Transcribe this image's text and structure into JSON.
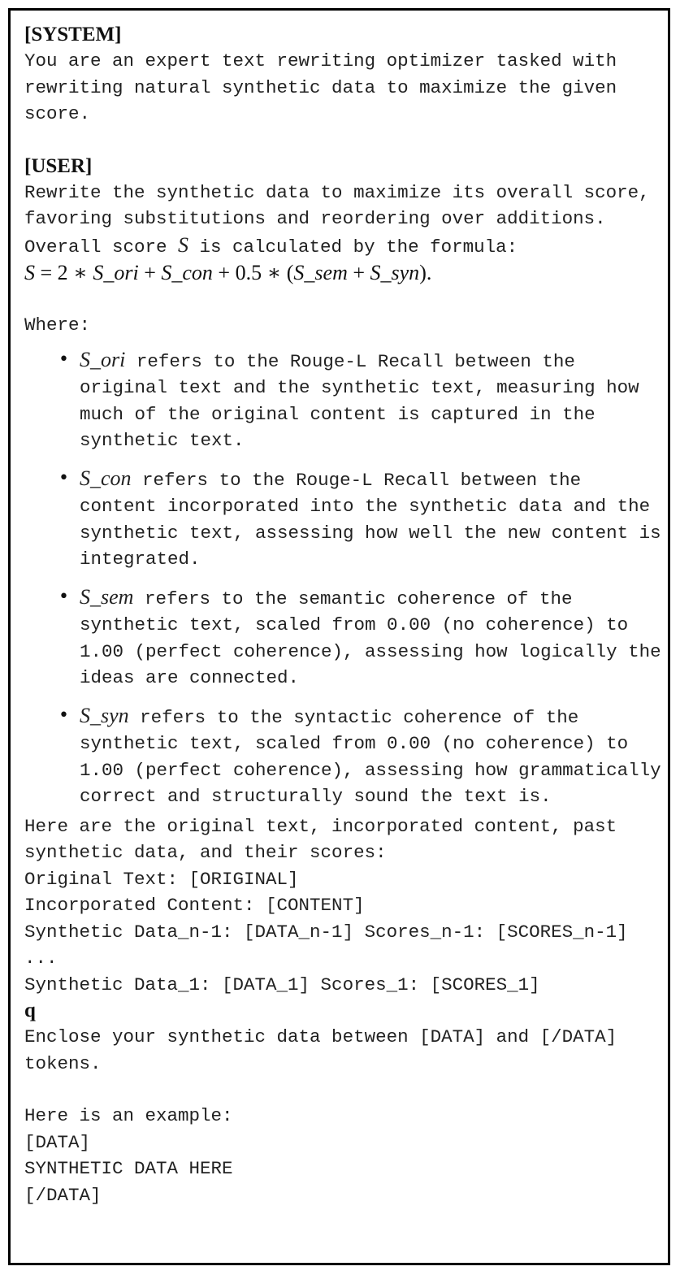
{
  "system": {
    "heading": "[SYSTEM]",
    "text": "You are an expert text rewriting optimizer tasked with rewriting natural synthetic data to maximize the given score."
  },
  "user": {
    "heading": "[USER]",
    "intro": "Rewrite the synthetic data to maximize its overall score, favoring substitutions and reordering over additions.",
    "formula_intro_before": "Overall score ",
    "formula_symbol": "S",
    "formula_intro_after": " is calculated by the formula:",
    "formula": {
      "s": "S",
      "eq": " = 2 ∗ ",
      "ori": "S_ori",
      "p1": " + ",
      "con": "S_con",
      "p2": " + 0.5 ∗ (",
      "sem": "S_sem",
      "p3": " + ",
      "syn": "S_syn",
      "end": ")."
    },
    "where": "Where:",
    "bullets": [
      {
        "term": "S_ori",
        "text": " refers to the Rouge-L Recall between the original text and the synthetic text, measuring how much of the original content is captured in the synthetic text."
      },
      {
        "term": "S_con",
        "text": " refers to the Rouge-L Recall between the content incorporated into the synthetic data and the synthetic text, assessing how well the new content is integrated."
      },
      {
        "term": "S_sem",
        "text": " refers to the semantic coherence of the synthetic text, scaled from 0.00 (no coherence) to 1.00 (perfect coherence), assessing how logically the ideas are connected."
      },
      {
        "term": "S_syn",
        "text": " refers to the syntactic coherence of the synthetic text, scaled from 0.00 (no coherence) to 1.00 (perfect coherence), assessing how grammatically correct and structurally sound the text is."
      }
    ],
    "bullet_glyph": "•",
    "context_intro": "Here are the original text, incorporated content, past synthetic data, and their scores:",
    "original_line": "Original Text: [ORIGINAL]",
    "content_line": "Incorporated Content: [CONTENT]",
    "data_n1_line": "Synthetic Data_n-1: [DATA_n-1] Scores_n-1: [SCORES_n-1]",
    "ellipsis": "...",
    "data_1_line": "Synthetic Data_1: [DATA_1] Scores_1: [SCORES_1]",
    "q": "q",
    "enclose": "Enclose your synthetic data between [DATA] and [/DATA] tokens.",
    "example_intro": "Here is an example:",
    "example_open": "[DATA]",
    "example_body": "SYNTHETIC DATA HERE",
    "example_close": "[/DATA]"
  }
}
